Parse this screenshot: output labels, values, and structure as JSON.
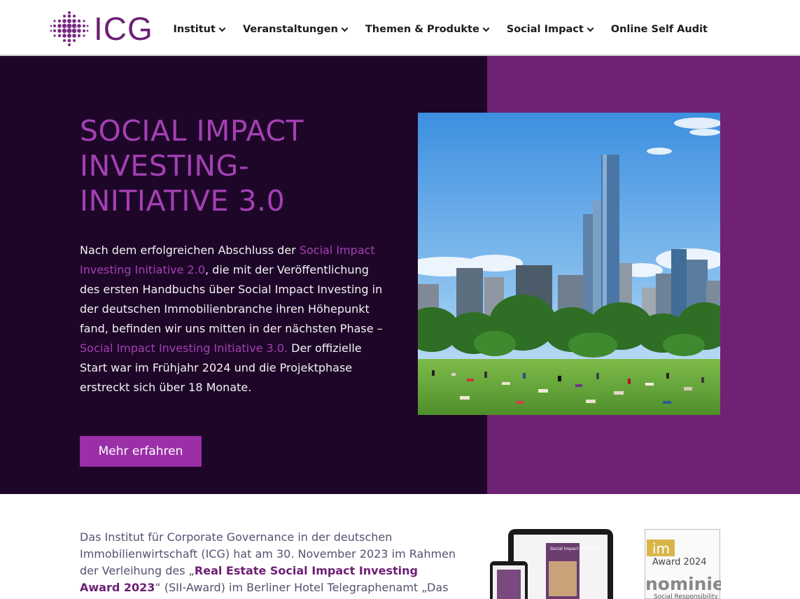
{
  "brand": {
    "name": "ICG",
    "logo_color": "#6c1f74"
  },
  "nav": {
    "items": [
      {
        "label": "Institut",
        "dropdown": true
      },
      {
        "label": "Veranstaltungen",
        "dropdown": true
      },
      {
        "label": "Themen & Produkte",
        "dropdown": true
      },
      {
        "label": "Social Impact",
        "dropdown": true
      },
      {
        "label": "Online Self Audit",
        "dropdown": false
      }
    ]
  },
  "hero": {
    "title_lines": [
      "SOCIAL IMPACT",
      "INVESTING-",
      "INITIATIVE 3.0"
    ],
    "text": {
      "p1": "Nach dem erfolgreichen Abschluss der ",
      "link1": "Social Impact Investing Initiative 2.0",
      "p2": ", die mit der Veröffentlichung des ersten Handbuchs über Social Impact Investing in der deutschen Immobilienbranche ihren Höhepunkt fand, befinden wir uns mitten in der nächsten Phase – ",
      "link2": "Social Impact Investing Initiative 3.0.",
      "p3": " Der offizielle Start war im Frühjahr 2024 und die Projektphase erstreckt sich über 18 Monate."
    },
    "button_label": "Mehr erfahren",
    "colors": {
      "left_bg": "#1e0629",
      "right_bg": "#6f2273",
      "accent": "#a440b3"
    }
  },
  "lower": {
    "text": {
      "p1": "Das Institut für Corporate Governance in der deutschen Immobilienwirtschaft (ICG) hat am 30. November 2023 im Rahmen der Verleihung des „",
      "bold": "Real Estate Social Impact Investing Award 2023",
      "p2": "“ (SII-Award) im Berliner Hotel Telegraphenamt „Das"
    },
    "award": {
      "line1": "im",
      "line2": "Award 2024",
      "line3": "nominiert",
      "line4": "Social Responsibility"
    },
    "devices_book_title": "Social Impact Investing"
  }
}
